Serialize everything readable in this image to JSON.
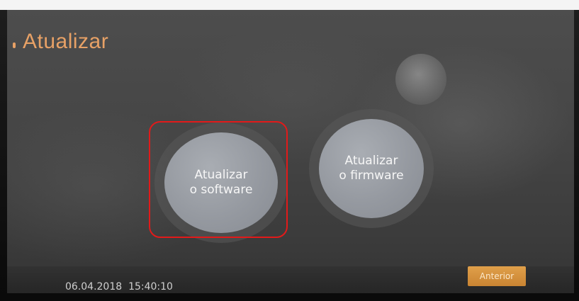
{
  "screen": {
    "title": "Atualizar"
  },
  "buttons": {
    "software": {
      "line1": "Atualizar",
      "line2": "o software"
    },
    "firmware": {
      "line1": "Atualizar",
      "line2": "o firmware"
    }
  },
  "footer": {
    "date": "06.04.2018",
    "time": "15:40:10",
    "previous_label": "Anterior"
  },
  "colors": {
    "title": "#e7a166",
    "accent_button": "#d8963e",
    "highlight": "#e21a1a"
  }
}
